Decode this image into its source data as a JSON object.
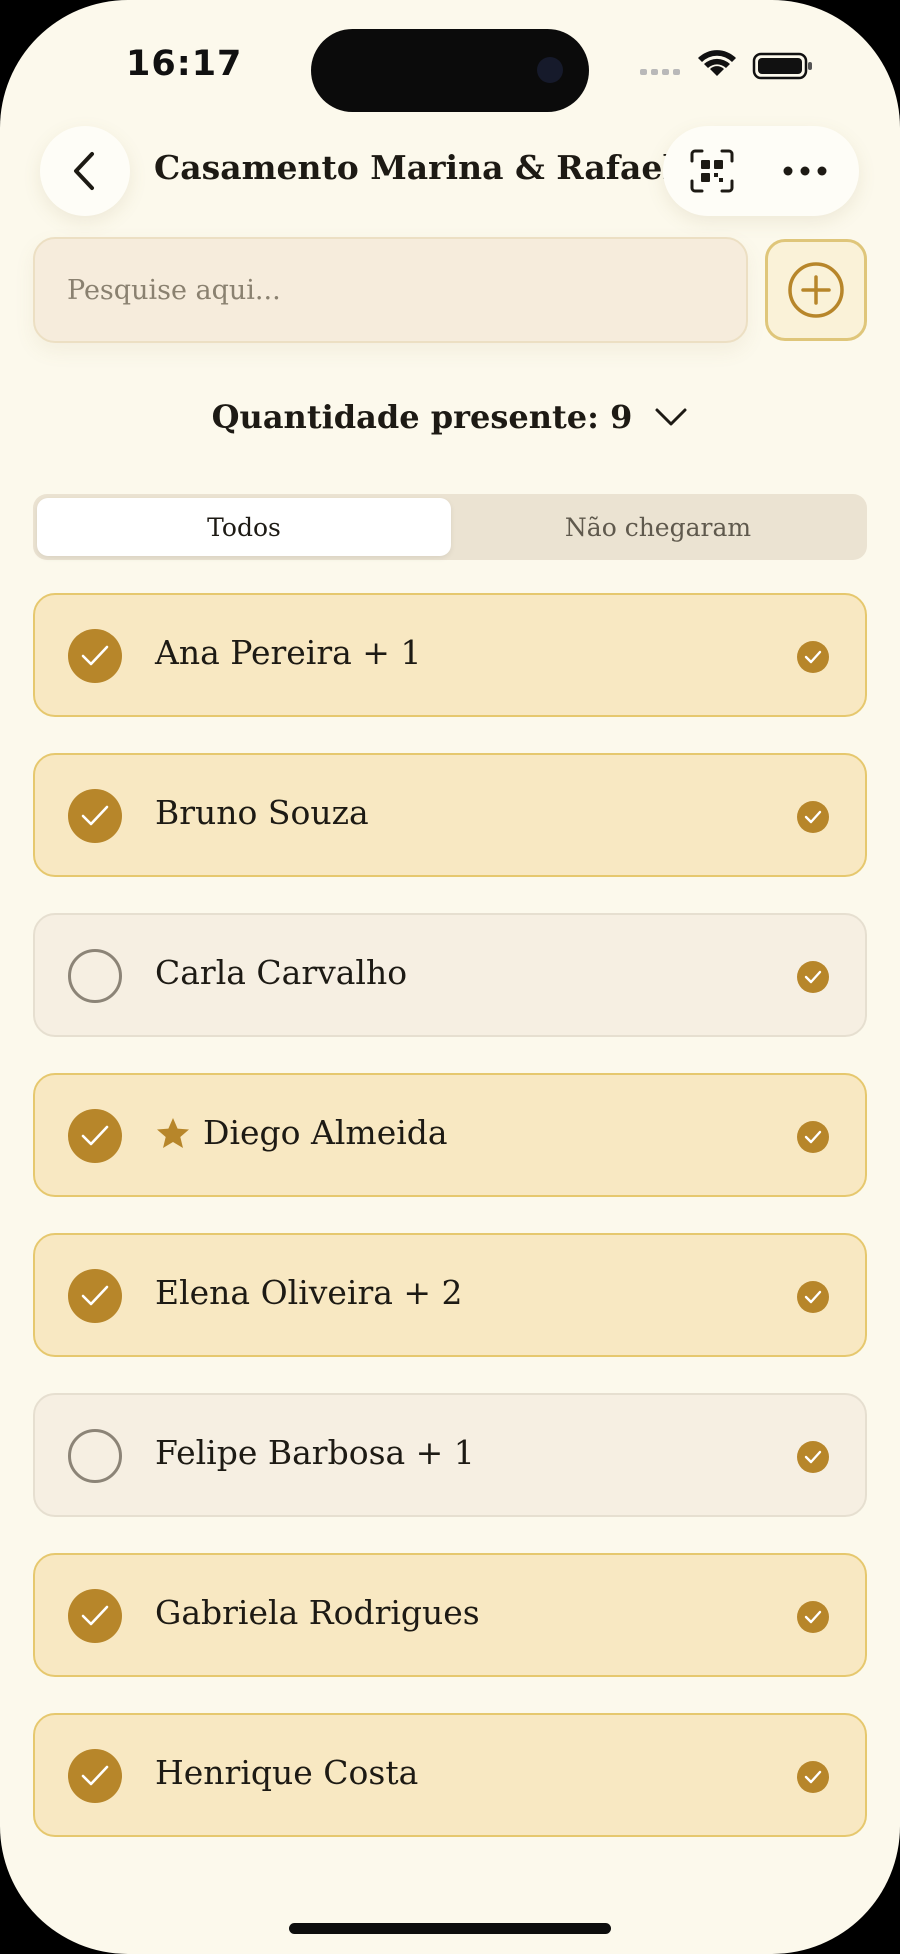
{
  "status_bar": {
    "time": "16:17"
  },
  "header": {
    "title": "Casamento Marina & Rafael"
  },
  "search": {
    "placeholder": "Pesquise aqui..."
  },
  "count": {
    "label": "Quantidade presente: 9"
  },
  "tabs": [
    {
      "label": "Todos",
      "active": true
    },
    {
      "label": "Não chegaram",
      "active": false
    }
  ],
  "guests": [
    {
      "name": "Ana Pereira + 1",
      "checked_in": true,
      "starred": false
    },
    {
      "name": "Bruno Souza",
      "checked_in": true,
      "starred": false
    },
    {
      "name": "Carla Carvalho",
      "checked_in": false,
      "starred": false
    },
    {
      "name": "Diego Almeida",
      "checked_in": true,
      "starred": true
    },
    {
      "name": "Elena Oliveira + 2",
      "checked_in": true,
      "starred": false
    },
    {
      "name": "Felipe Barbosa + 1",
      "checked_in": false,
      "starred": false
    },
    {
      "name": "Gabriela Rodrigues",
      "checked_in": true,
      "starred": false
    },
    {
      "name": "Henrique Costa",
      "checked_in": true,
      "starred": false
    }
  ],
  "colors": {
    "accent": "#b7862a",
    "background": "#fcf9ec",
    "row_checked": "#f8e8c2",
    "row_pending": "#f6efe2"
  }
}
